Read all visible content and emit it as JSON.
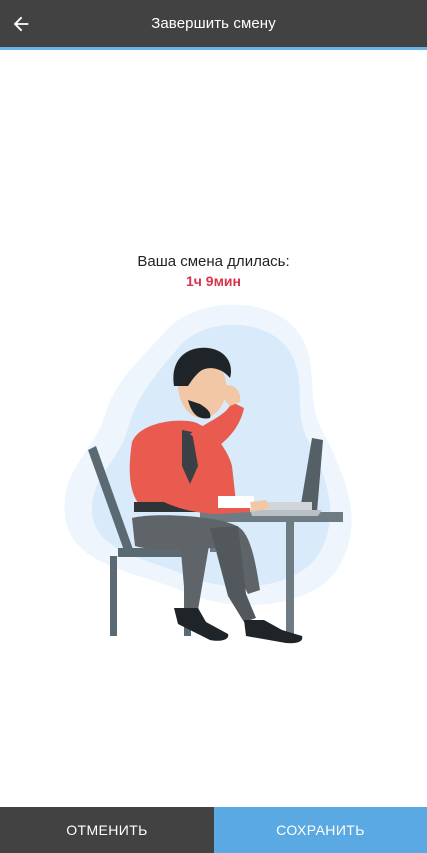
{
  "header": {
    "title": "Завершить смену",
    "back_icon": "arrow-left-icon"
  },
  "main": {
    "duration_label": "Ваша смена длилась:",
    "duration_value": "1ч 9мин",
    "illustration": "tired-man-at-laptop-illustration"
  },
  "footer": {
    "cancel_label": "ОТМЕНИТЬ",
    "save_label": "СОХРАНИТЬ"
  },
  "colors": {
    "appbar": "#424242",
    "accent": "#6fb2e6",
    "duration": "#d8344c",
    "save_button": "#5aa9e2",
    "cancel_button": "#424242"
  }
}
